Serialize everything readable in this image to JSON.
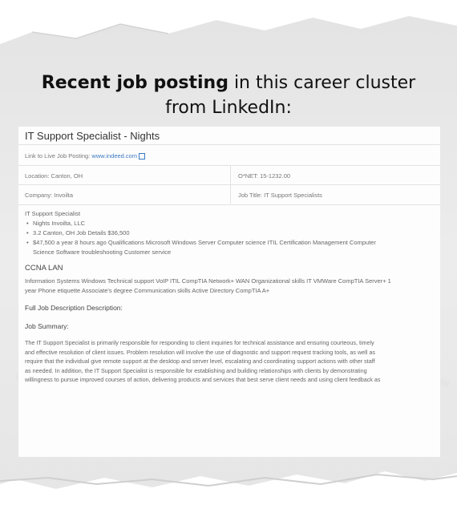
{
  "page": {
    "heading_bold": "Recent job posting",
    "heading_rest": " in this career cluster from LinkedIn:"
  },
  "posting": {
    "title": "IT Support Specialist - Nights",
    "link_label": "Link to Live Job Posting:",
    "link_text": "www.indeed.com",
    "location": "Location: Canton, OH",
    "onet": "O*NET: 15-1232.00",
    "company": "Company: Invoilta",
    "job_title": "Job Title: IT Support Specialists",
    "intro": "IT Support Specialist",
    "bullets": [
      "Nights Invoilta, LLC",
      "3.2 Canton, OH Job Details $36,500",
      "$47,500 a year 8 hours ago Qualifications Microsoft Windows Server Computer science ITIL Certification Management Computer",
      "Science Software troubleshooting Customer service"
    ],
    "ccna_heading": "CCNA LAN",
    "ccna_line1": "Information Systems Windows Technical support VoIP ITIL CompTIA Network+ WAN Organizational skills IT VMWare CompTIA Server+ 1",
    "ccna_line2": "year Phone etiquette Associate's degree Communication skills Active Directory CompTIA A+",
    "full_desc": "Full Job Description Description:",
    "summary_heading": "Job Summary:",
    "summary_lines": [
      "The IT Support Specialist is primarily responsible for responding to client inquiries for technical assistance and ensuring courteous, timely",
      "and effective resolution of client issues. Problem resolution will involve the use of diagnostic and support request tracking tools, as well as",
      "require that the individual give remote support at the desktop and server level, escalating and coordinating support actions with other staff",
      "as needed. In addition, the IT Support Specialist is responsible for establishing and building relationships with clients by demonstrating",
      "willingness to pursue improved courses of action, delivering products and services that best serve client needs and using client feedback as"
    ]
  }
}
